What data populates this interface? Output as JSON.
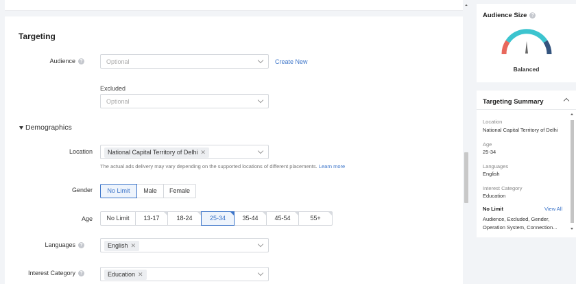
{
  "targeting": {
    "title": "Targeting",
    "audience": {
      "label": "Audience",
      "placeholder": "Optional",
      "create_new": "Create New"
    },
    "excluded": {
      "label": "Excluded",
      "placeholder": "Optional"
    },
    "demographics": {
      "title": "Demographics",
      "location": {
        "label": "Location",
        "tag": "National Capital Territory of Delhi",
        "note": "The actual ads delivery may vary depending on the supported locations of different placements.",
        "note_link": "Learn more"
      },
      "gender": {
        "label": "Gender",
        "options": [
          "No Limit",
          "Male",
          "Female"
        ],
        "selected": "No Limit"
      },
      "age": {
        "label": "Age",
        "options": [
          "No Limit",
          "13-17",
          "18-24",
          "25-34",
          "35-44",
          "45-54",
          "55+"
        ],
        "selected": "25-34"
      },
      "languages": {
        "label": "Languages",
        "tag": "English"
      },
      "interest": {
        "label": "Interest Category",
        "tag": "Education"
      }
    }
  },
  "audience_size": {
    "title": "Audience Size",
    "status": "Balanced",
    "gauge_colors": {
      "low": "#e8685c",
      "mid": "#3cc4cf",
      "high": "#34547e"
    }
  },
  "targeting_summary": {
    "title": "Targeting Summary",
    "items": [
      {
        "label": "Location",
        "value": "National Capital Territory of Delhi"
      },
      {
        "label": "Age",
        "value": "25-34"
      },
      {
        "label": "Languages",
        "value": "English"
      },
      {
        "label": "Interest Category",
        "value": "Education"
      }
    ],
    "no_limit": {
      "title": "No Limit",
      "view_all": "View All",
      "line1": "Audience, Excluded, Gender,",
      "line2": "Operation System, Connection..."
    }
  },
  "icons": {
    "help": "question-circle-icon",
    "collapse": "chevron-up-icon",
    "dropdown": "chevron-down-icon",
    "remove": "close-icon",
    "expand": "caret-down-icon"
  },
  "colors": {
    "accent": "#3a73c8",
    "page_bg": "#f2f4f7"
  }
}
